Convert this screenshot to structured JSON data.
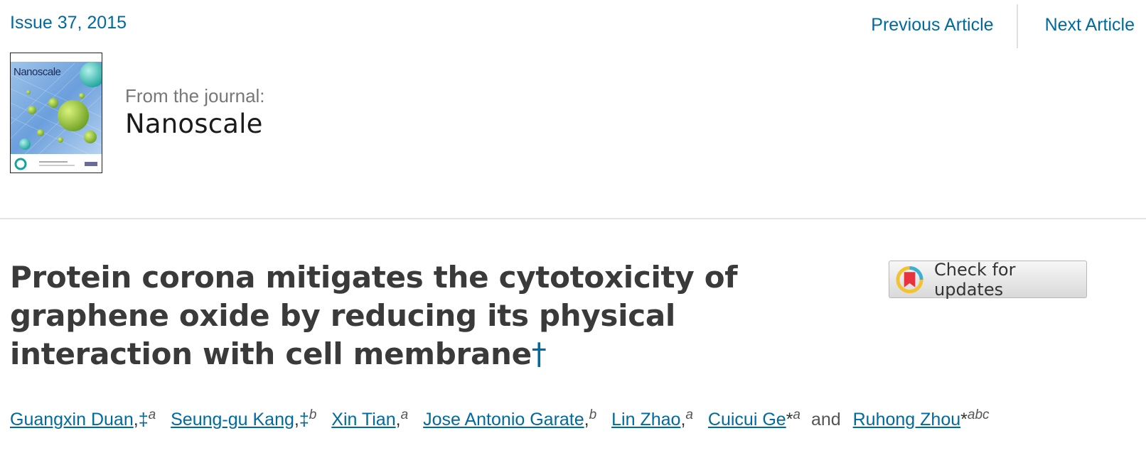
{
  "nav": {
    "issue": "Issue 37, 2015",
    "previous": "Previous Article",
    "next": "Next Article"
  },
  "journal": {
    "from_label": "From the journal:",
    "name": "Nanoscale",
    "cover_title": "Nanoscale"
  },
  "article": {
    "title": "Protein corona mitigates the cytotoxicity of graphene oxide by reducing its physical interaction with cell membrane",
    "title_mark": "†"
  },
  "check_updates": {
    "label": "Check for updates"
  },
  "authors": [
    {
      "name": "Guangxin Duan",
      "marks": "‡",
      "affil": "a"
    },
    {
      "name": "Seung-gu Kang",
      "marks": "‡",
      "affil": "b"
    },
    {
      "name": "Xin Tian",
      "marks": "",
      "affil": "a"
    },
    {
      "name": "Jose Antonio Garate",
      "marks": "",
      "affil": "b"
    },
    {
      "name": "Lin Zhao",
      "marks": "",
      "affil": "a"
    },
    {
      "name": "Cuicui Ge",
      "marks": "*",
      "affil": "a"
    },
    {
      "name": "Ruhong Zhou",
      "marks": "*",
      "affil": "abc"
    }
  ],
  "authors_conjunction": "and",
  "colors": {
    "link": "#006a9e",
    "title": "#3a3a3a",
    "divider": "#e3e3e3"
  }
}
